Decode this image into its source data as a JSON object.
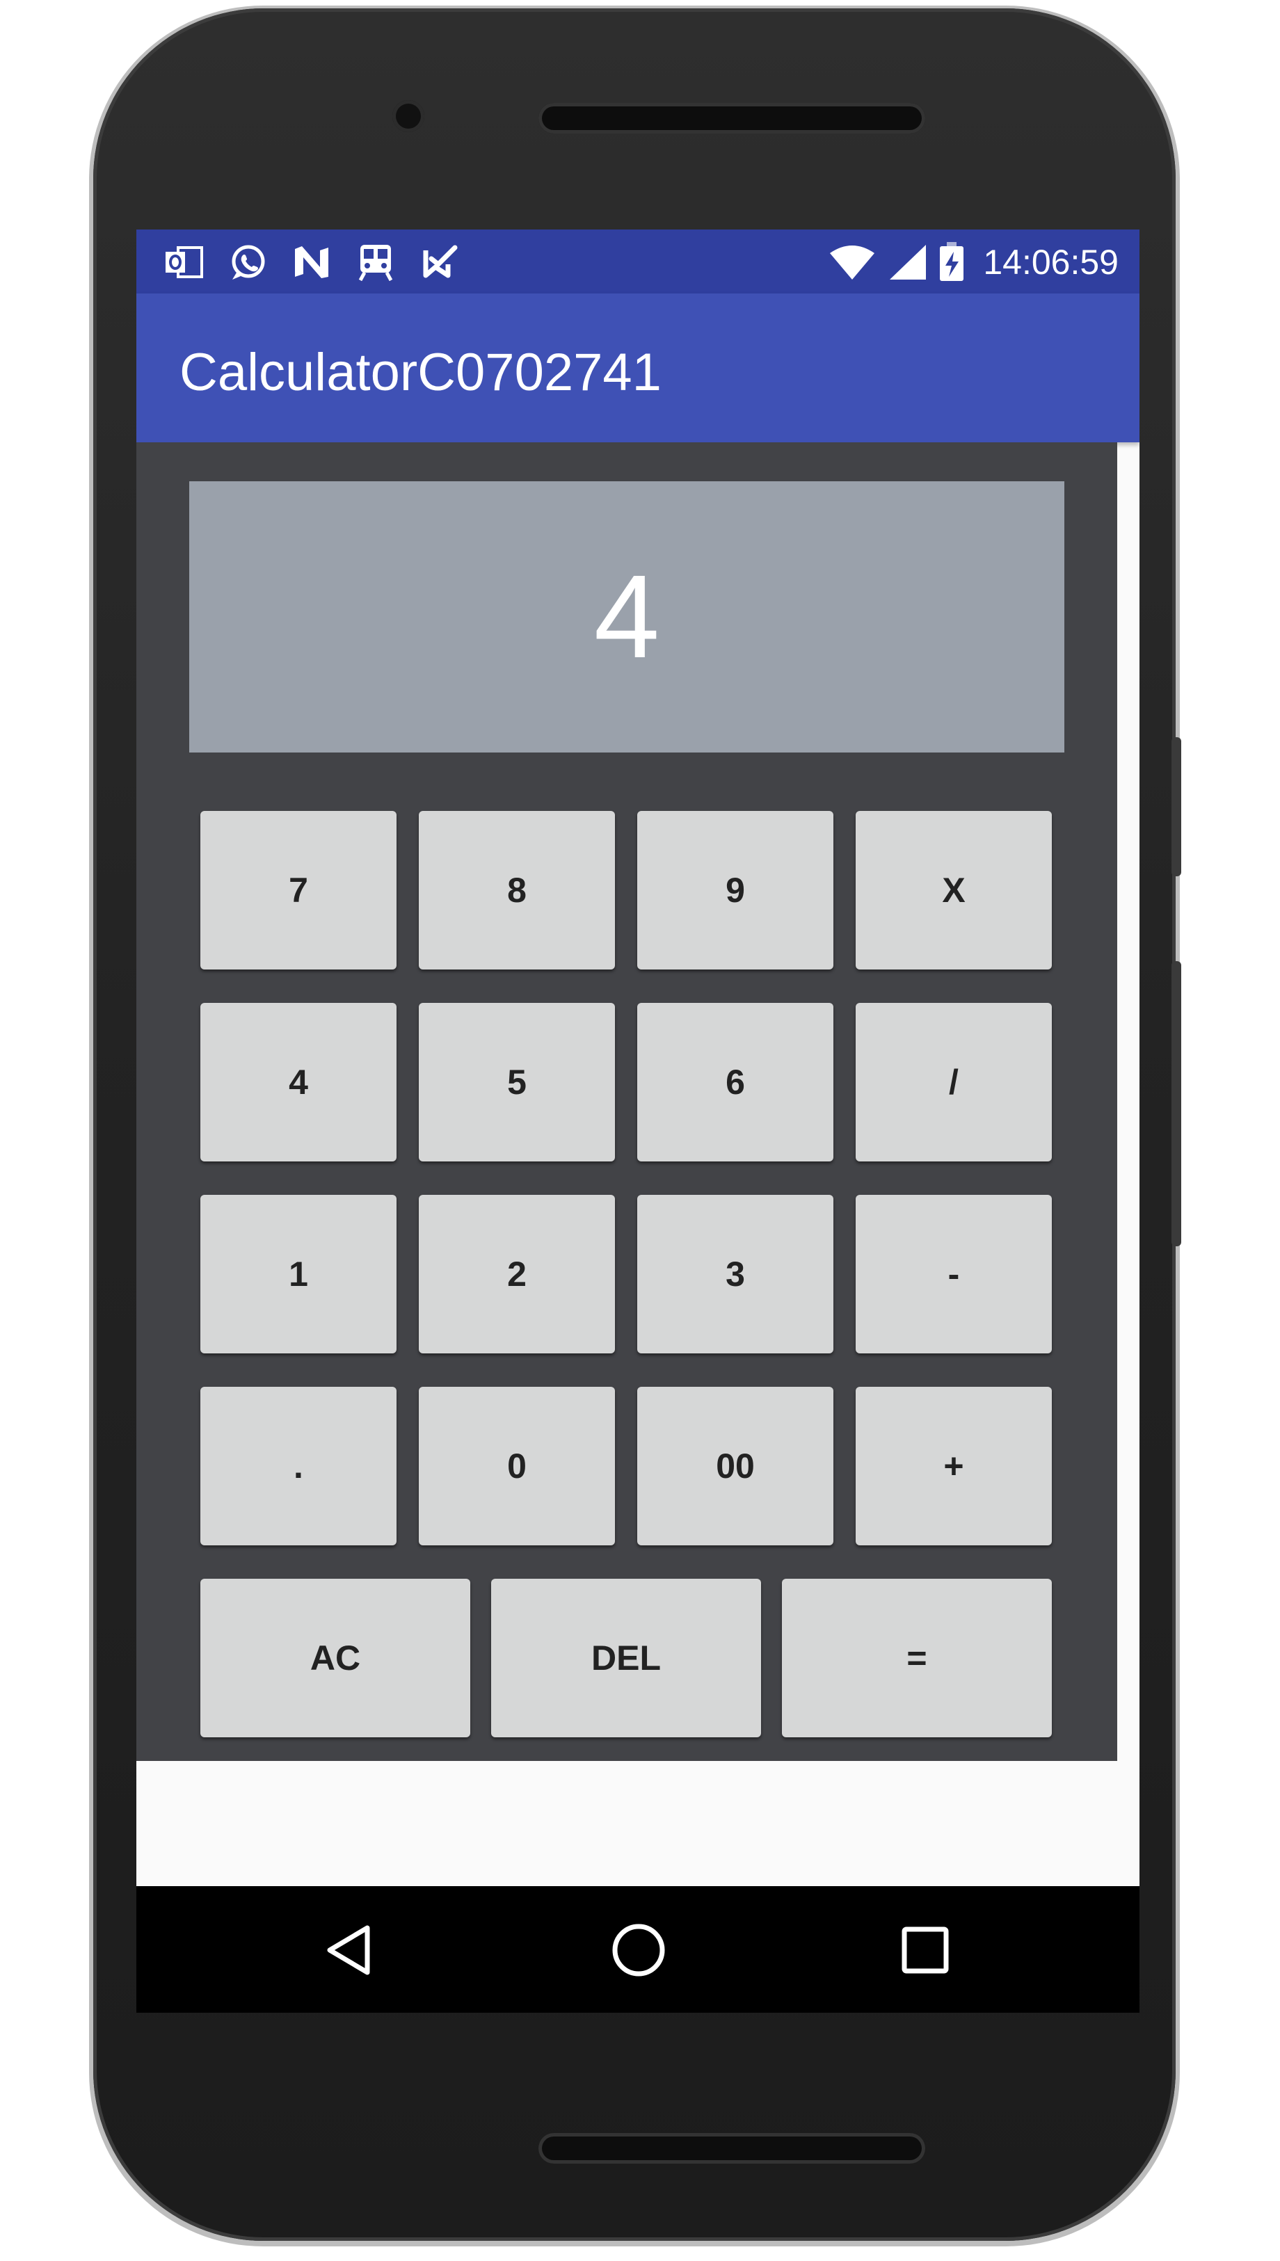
{
  "status_bar": {
    "time": "14:06:59",
    "left_icons": [
      "outlook-icon",
      "whatsapp-icon",
      "n-app-icon",
      "train-icon",
      "checklist-icon"
    ],
    "right_icons": [
      "wifi-icon",
      "signal-icon",
      "battery-charging-icon"
    ],
    "color": "#303f9f"
  },
  "app_bar": {
    "title": "CalculatorC0702741",
    "color": "#3f51b5"
  },
  "calculator": {
    "display_value": "4",
    "panel_color": "#424347",
    "display_color": "#9aa1ab",
    "key_color": "#d6d7d7",
    "rows": [
      [
        "7",
        "8",
        "9",
        "X"
      ],
      [
        "4",
        "5",
        "6",
        "/"
      ],
      [
        "1",
        "2",
        "3",
        "-"
      ],
      [
        ".",
        "0",
        "00",
        "+"
      ],
      [
        "AC",
        "DEL",
        "="
      ]
    ]
  },
  "nav_bar": {
    "buttons": [
      "back-icon",
      "home-icon",
      "recents-icon"
    ]
  }
}
